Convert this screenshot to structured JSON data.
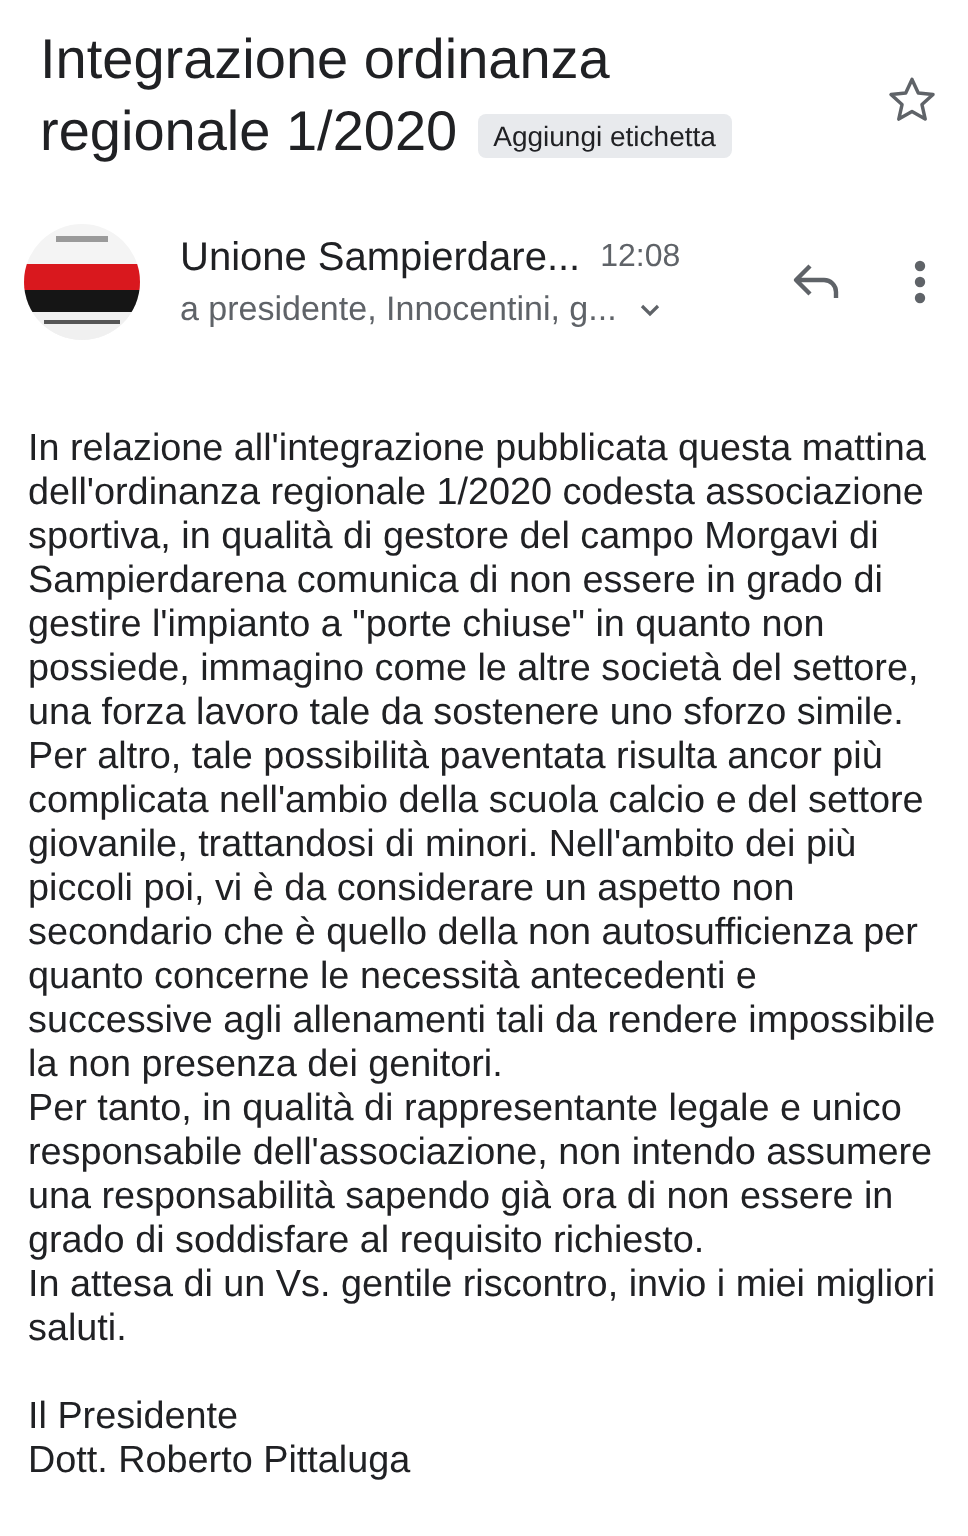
{
  "subject": {
    "title_lines": [
      "Integrazione ordinanza",
      "regionale 1/2020"
    ],
    "label_chip": "Aggiungi etichetta",
    "starred": false
  },
  "message": {
    "sender": "Unione Sampierdare...",
    "time": "12:08",
    "recipients": "a presidente, Innocentini, g..."
  },
  "body": [
    "In relazione all'integrazione pubblicata questa mattina dell'ordinanza regionale 1/2020 codesta associazione sportiva, in qualità di gestore del campo Morgavi di Sampierdarena comunica di non essere in grado di gestire l'impianto a \"porte chiuse\" in quanto non possiede, immagino come le altre società del settore, una forza lavoro tale da sostenere uno sforzo simile. Per altro, tale possibilità paventata risulta ancor più complicata nell'ambio della scuola calcio e del settore giovanile, trattandosi di minori. Nell'ambito dei più piccoli poi, vi è da considerare un aspetto non secondario che è quello della non autosufficienza per quanto concerne le necessità antecedenti e successive agli allenamenti tali da rendere impossibile la non presenza dei genitori.",
    "Per tanto, in qualità di rappresentante legale e unico responsabile dell'associazione, non intendo assumere una responsabilità sapendo già ora di non essere in grado di soddisfare al requisito richiesto.",
    "In attesa di un Vs. gentile riscontro, invio i miei migliori saluti."
  ],
  "signature": [
    "Il Presidente",
    "Dott. Roberto Pittaluga"
  ]
}
